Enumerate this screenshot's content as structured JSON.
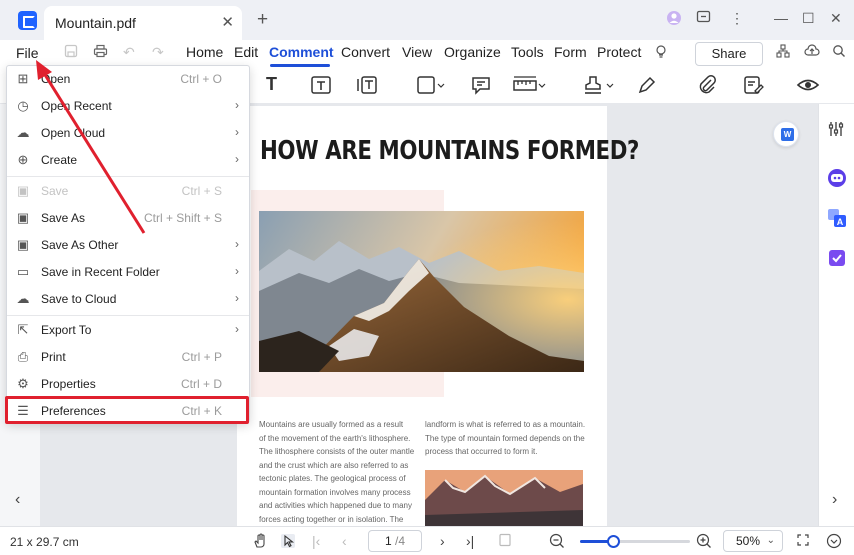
{
  "tab": {
    "title": "Mountain.pdf",
    "close": "✕",
    "new_tab": "+"
  },
  "window_controls": {
    "avatar": "●",
    "chat": "▢",
    "more": "⋮",
    "minimize": "—",
    "maximize": "☐",
    "close": "✕"
  },
  "menubar": {
    "file": "File",
    "items": [
      "Home",
      "Edit",
      "Comment",
      "Convert",
      "View",
      "Organize",
      "Tools",
      "Form",
      "Protect"
    ],
    "active_index": 2,
    "share": "Share"
  },
  "dropdown": {
    "items": [
      {
        "label": "Open",
        "shortcut": "Ctrl + O",
        "icon": "plus-square-icon",
        "glyph": "⊞",
        "submenu": false,
        "disabled": false
      },
      {
        "label": "Open Recent",
        "shortcut": "",
        "icon": "clock-icon",
        "glyph": "◷",
        "submenu": true,
        "disabled": false
      },
      {
        "label": "Open Cloud",
        "shortcut": "",
        "icon": "cloud-icon",
        "glyph": "☁",
        "submenu": true,
        "disabled": false
      },
      {
        "label": "Create",
        "shortcut": "",
        "icon": "create-document-icon",
        "glyph": "⊕",
        "submenu": true,
        "disabled": false
      },
      {
        "label": "Save",
        "shortcut": "Ctrl + S",
        "icon": "save-icon",
        "glyph": "▣",
        "submenu": false,
        "disabled": true
      },
      {
        "label": "Save As",
        "shortcut": "Ctrl + Shift + S",
        "icon": "save-as-icon",
        "glyph": "▣",
        "submenu": false,
        "disabled": false
      },
      {
        "label": "Save As Other",
        "shortcut": "",
        "icon": "save-as-other-icon",
        "glyph": "▣",
        "submenu": true,
        "disabled": false
      },
      {
        "label": "Save in Recent Folder",
        "shortcut": "",
        "icon": "folder-icon",
        "glyph": "▭",
        "submenu": true,
        "disabled": false
      },
      {
        "label": "Save to Cloud",
        "shortcut": "",
        "icon": "cloud-upload-icon",
        "glyph": "☁",
        "submenu": true,
        "disabled": false
      },
      {
        "label": "Export To",
        "shortcut": "",
        "icon": "export-icon",
        "glyph": "⇱",
        "submenu": true,
        "disabled": false
      },
      {
        "label": "Print",
        "shortcut": "Ctrl + P",
        "icon": "print-icon",
        "glyph": "⎙",
        "submenu": false,
        "disabled": false
      },
      {
        "label": "Properties",
        "shortcut": "Ctrl + D",
        "icon": "properties-icon",
        "glyph": "⚙",
        "submenu": false,
        "disabled": false
      },
      {
        "label": "Preferences",
        "shortcut": "Ctrl + K",
        "icon": "preferences-sliders-icon",
        "glyph": "☰",
        "submenu": false,
        "disabled": false
      }
    ],
    "arrow": "›"
  },
  "document": {
    "title": "HOW ARE MOUNTAINS FORMED?",
    "col1": [
      "Mountains are usually formed as a result",
      "of the movement of the earth's lithosphere.",
      "The lithosphere consists of the outer mantle",
      "and the crust which are also referred to as",
      "tectonic plates. The geological process of",
      "mountain formation involves many process",
      "and activities which happened due to many",
      "forces acting together or in isolation. The"
    ],
    "col2": [
      "landform is what is referred to as a mountain.",
      "The type of mountain formed depends on the",
      "process that occurred to form it."
    ]
  },
  "statusbar": {
    "page_size": "21 x 29.7 cm",
    "current_page": "1",
    "total_pages": "/4",
    "zoom": "50%",
    "zoom_fraction": 0.3
  },
  "colors": {
    "accent": "#1e4fd8",
    "highlight": "#e0202e",
    "logo": "#1f63ff"
  }
}
